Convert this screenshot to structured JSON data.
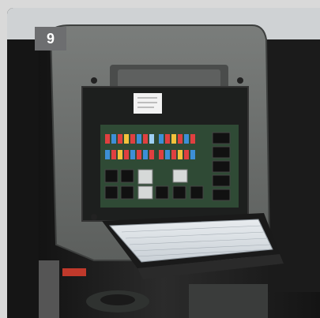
{
  "step_badge": {
    "number": "9"
  },
  "colors": {
    "badge_background": "#6d6e70",
    "badge_text": "#ffffff",
    "frame_border": "#d9d9d9"
  },
  "photo": {
    "subject_icon": "fuse-relay-panel-photo"
  }
}
